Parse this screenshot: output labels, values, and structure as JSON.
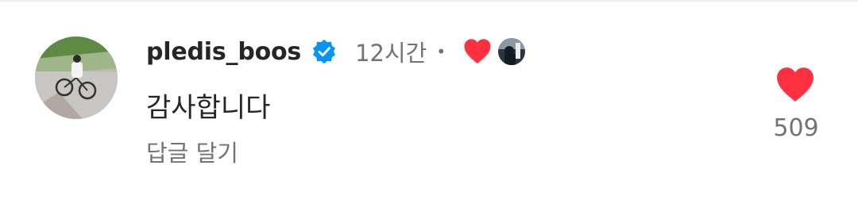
{
  "comment": {
    "username": "pledis_boos",
    "verified": true,
    "timestamp": "12시간",
    "separator": "•",
    "text": "감사합니다",
    "reply_label": "답글 달기",
    "like_count": "509",
    "liked_by_creator": true,
    "liked": true
  },
  "colors": {
    "heart_red": "#ff3040",
    "verified_blue": "#0095f6",
    "primary_text": "#262626",
    "secondary_text": "#737373"
  },
  "icons": {
    "verified": "verified-badge-icon",
    "creator_heart": "heart-filled-icon",
    "like": "heart-filled-icon"
  }
}
